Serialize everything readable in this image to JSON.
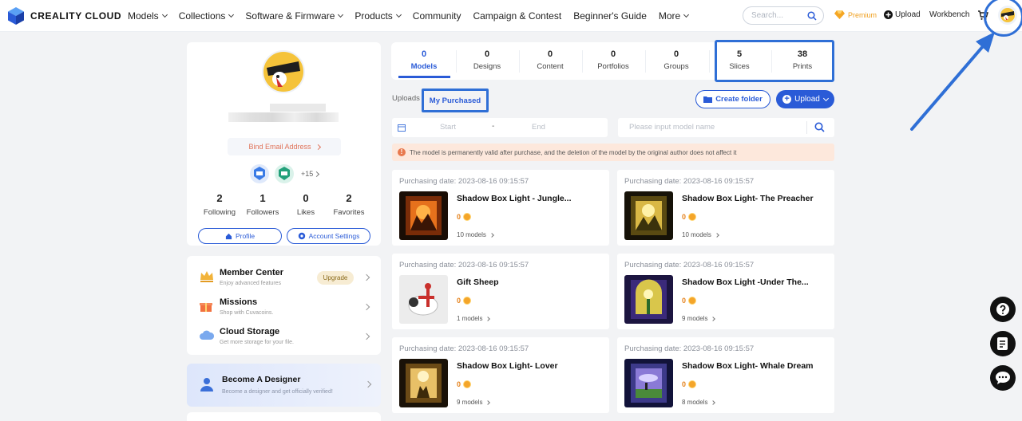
{
  "brand": {
    "name": "CREALITY CLOUD",
    "logo_icon": "creality-cube-logo"
  },
  "nav": {
    "items": [
      "Models",
      "Collections",
      "Software & Firmware",
      "Products",
      "Community",
      "Campaign & Contest",
      "Beginner's Guide",
      "More"
    ]
  },
  "header": {
    "search_placeholder": "Search...",
    "premium_label": "Premium",
    "upload_label": "Upload",
    "workbench_label": "Workbench"
  },
  "profile": {
    "bind_email": "Bind Email Address",
    "badges_more": "+15",
    "stats": [
      {
        "value": "2",
        "label": "Following"
      },
      {
        "value": "1",
        "label": "Followers"
      },
      {
        "value": "0",
        "label": "Likes"
      },
      {
        "value": "2",
        "label": "Favorites"
      }
    ],
    "profile_button": "Profile",
    "settings_button": "Account Settings"
  },
  "menu": {
    "member_center": {
      "title": "Member Center",
      "subtitle": "Enjoy advanced features",
      "upgrade": "Upgrade"
    },
    "missions": {
      "title": "Missions",
      "subtitle": "Shop with Cuvacoins."
    },
    "cloud_storage": {
      "title": "Cloud Storage",
      "subtitle": "Get more storage for your file."
    }
  },
  "designer": {
    "title": "Become A Designer",
    "subtitle": "Become a designer and get officially verified!"
  },
  "tabs": [
    {
      "count": "0",
      "label": "Models"
    },
    {
      "count": "0",
      "label": "Designs"
    },
    {
      "count": "0",
      "label": "Content"
    },
    {
      "count": "0",
      "label": "Portfolios"
    },
    {
      "count": "0",
      "label": "Groups"
    },
    {
      "count": "5",
      "label": "Slices"
    },
    {
      "count": "38",
      "label": "Prints"
    }
  ],
  "subtabs": {
    "uploads": "Uploads",
    "my_purchased": "My Purchased"
  },
  "actions": {
    "create_folder": "Create folder",
    "upload": "Upload"
  },
  "filters": {
    "start": "Start",
    "dash": "-",
    "end": "End",
    "model_search_placeholder": "Please input model name"
  },
  "notice": "The model is permanently valid after purchase, and the deletion of the model by the original author does not affect it",
  "purchases": [
    {
      "date": "Purchasing date: 2023-08-16 09:15:57",
      "title": "Shadow Box Light - Jungle...",
      "price": "0",
      "models": "10 models"
    },
    {
      "date": "Purchasing date: 2023-08-16 09:15:57",
      "title": "Shadow Box Light- The Preacher",
      "price": "0",
      "models": "10 models"
    },
    {
      "date": "Purchasing date: 2023-08-16 09:15:57",
      "title": "Gift Sheep",
      "price": "0",
      "models": "1 models"
    },
    {
      "date": "Purchasing date: 2023-08-16 09:15:57",
      "title": "Shadow Box Light -Under The...",
      "price": "0",
      "models": "9 models"
    },
    {
      "date": "Purchasing date: 2023-08-16 09:15:57",
      "title": "Shadow Box Light- Lover",
      "price": "0",
      "models": "9 models"
    },
    {
      "date": "Purchasing date: 2023-08-16 09:15:57",
      "title": "Shadow Box Light- Whale Dream",
      "price": "0",
      "models": "8 models"
    }
  ],
  "colors": {
    "accent": "#2a5bd7",
    "annotation": "#2f6fd6",
    "notice_bg": "#fde8dc"
  },
  "floating": {
    "icons": [
      "help-icon",
      "feedback-icon",
      "chat-icon"
    ]
  }
}
